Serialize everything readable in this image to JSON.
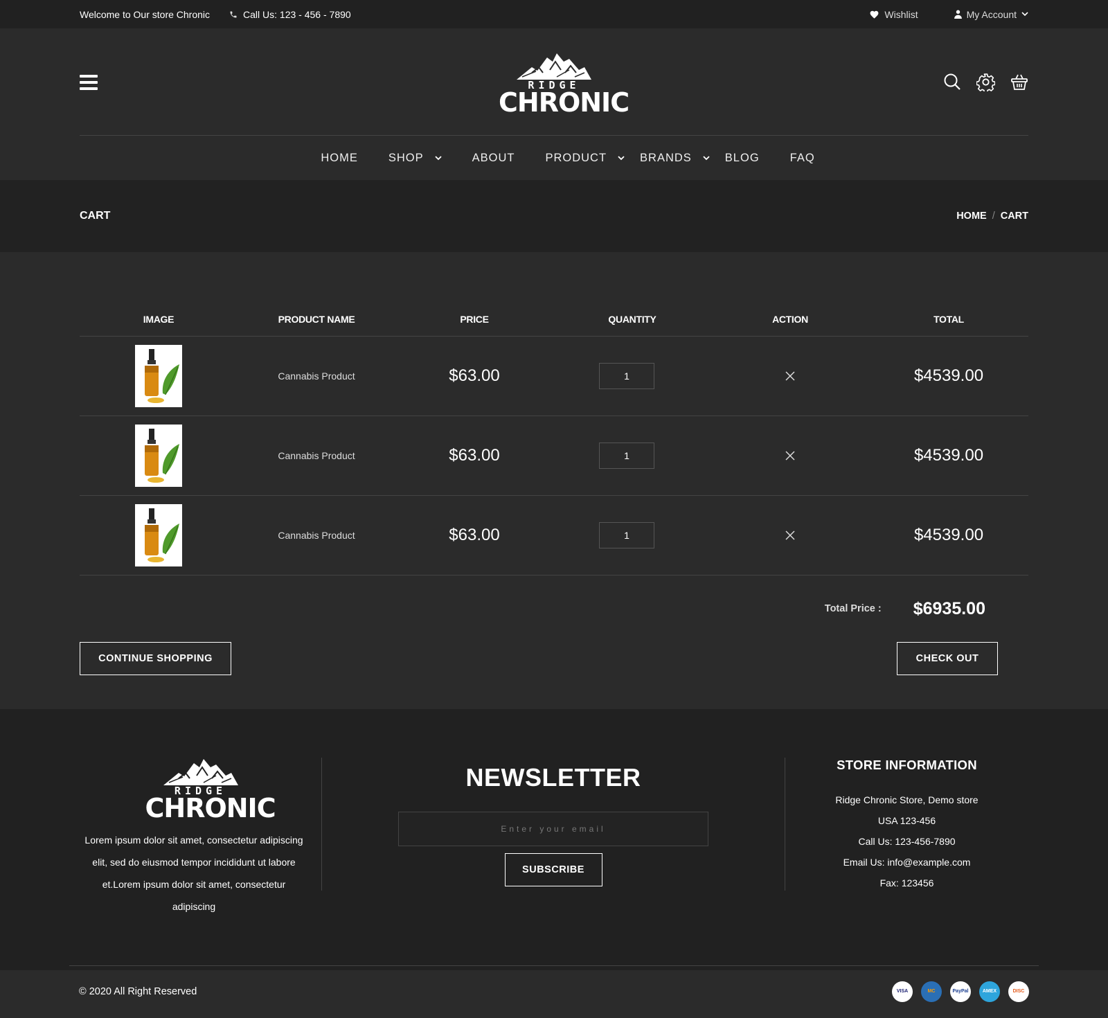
{
  "topbar": {
    "welcome": "Welcome to Our store Chronic",
    "phone": "Call Us: 123 - 456 - 7890",
    "wishlist": "Wishlist",
    "account": "My Account"
  },
  "logo": {
    "line1": "RIDGE",
    "line2": "CHRONIC"
  },
  "nav": {
    "items": [
      {
        "label": "HOME",
        "dropdown": false
      },
      {
        "label": "SHOP",
        "dropdown": true
      },
      {
        "label": "ABOUT",
        "dropdown": false
      },
      {
        "label": "PRODUCT",
        "dropdown": true
      },
      {
        "label": "BRANDS",
        "dropdown": true
      },
      {
        "label": "BLOG",
        "dropdown": false
      },
      {
        "label": "FAQ",
        "dropdown": false
      }
    ]
  },
  "breadcrumb": {
    "title": "CART",
    "home": "HOME",
    "sep": "/",
    "current": "CART"
  },
  "cart": {
    "headers": [
      "IMAGE",
      "PRODUCT NAME",
      "PRICE",
      "QUANTITY",
      "ACTION",
      "TOTAL"
    ],
    "rows": [
      {
        "name": "Cannabis Product",
        "price": "$63.00",
        "qty": "1",
        "total": "$4539.00"
      },
      {
        "name": "Cannabis Product",
        "price": "$63.00",
        "qty": "1",
        "total": "$4539.00"
      },
      {
        "name": "Cannabis Product",
        "price": "$63.00",
        "qty": "1",
        "total": "$4539.00"
      }
    ],
    "total_label": "Total Price :",
    "total_value": "$6935.00",
    "continue_label": "CONTINUE SHOPPING",
    "checkout_label": "CHECK OUT"
  },
  "footer": {
    "about_text": "Lorem ipsum dolor sit amet, consectetur adipiscing elit, sed do eiusmod tempor incididunt ut labore et.Lorem ipsum dolor sit amet, consectetur adipiscing",
    "newsletter_title": "NEWSLETTER",
    "email_placeholder": "Enter your email",
    "subscribe_label": "SUBSCRIBE",
    "store_title": "STORE INFORMATION",
    "store_lines": [
      "Ridge Chronic Store, Demo store",
      "USA 123-456",
      "Call Us: 123-456-7890",
      "Email Us: info@example.com",
      "Fax: 123456"
    ],
    "copyright": "© 2020 All Right Reserved",
    "payments": [
      {
        "name": "VISA",
        "color": "#ffffff",
        "text": "#1a1f71"
      },
      {
        "name": "MC",
        "color": "#2a6fb5",
        "text": "#ff9d00"
      },
      {
        "name": "PayPal",
        "color": "#ffffff",
        "text": "#1a3d8f"
      },
      {
        "name": "AMEX",
        "color": "#2ea5dc",
        "text": "#ffffff"
      },
      {
        "name": "DISC",
        "color": "#ffffff",
        "text": "#e45a1a"
      }
    ]
  },
  "colors": {
    "topbar_bg": "#212121",
    "page_bg": "#2b2b2b",
    "band_bg": "#222222",
    "text": "#ffffff"
  }
}
